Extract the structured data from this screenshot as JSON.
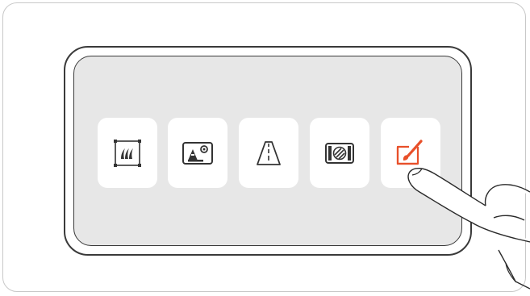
{
  "toolbar": {
    "icons": [
      {
        "name": "grass-frame-icon"
      },
      {
        "name": "image-adjust-icon"
      },
      {
        "name": "road-perspective-icon"
      },
      {
        "name": "lens-filter-icon"
      },
      {
        "name": "paint-brush-icon",
        "accent": "#e8502a",
        "state": "touched"
      }
    ]
  },
  "colors": {
    "accent": "#e8502a",
    "screen": "#e7e7e7",
    "outline": "#3a3a3a"
  }
}
